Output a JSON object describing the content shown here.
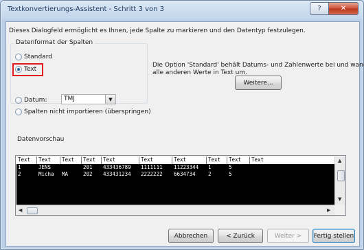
{
  "window": {
    "title": "Textkonvertierungs-Assistent - Schritt 3 von 3",
    "help_glyph": "?",
    "close_glyph": "✕"
  },
  "intro": "Dieses Dialogfeld ermöglicht es Ihnen, jede Spalte zu markieren und den Datentyp festzulegen.",
  "column_format": {
    "legend": "Datenformat der Spalten",
    "options": [
      {
        "label": "Standard",
        "selected": false
      },
      {
        "label": "Text",
        "selected": true
      },
      {
        "label": "Datum:",
        "selected": false
      },
      {
        "label": "Spalten nicht importieren (überspringen)",
        "selected": false
      }
    ],
    "date_value": "TMJ",
    "dropdown_glyph": "▼"
  },
  "description": {
    "line1": "Die Option 'Standard' behält Datums- und Zahlenwerte bei und wandelt",
    "line2": "alle anderen Werte in Text um."
  },
  "advanced_button": "Weitere...",
  "preview": {
    "legend": "Datenvorschau",
    "headers": [
      "Text",
      "Text",
      "Text",
      "Text",
      "Text",
      "Text",
      "Text",
      "Text",
      "Text",
      "Text"
    ],
    "rows": [
      [
        "1",
        "JENS",
        "",
        "201",
        "433436789",
        "1111111",
        "11223344",
        "1",
        "5",
        ""
      ],
      [
        "2",
        "Micha",
        "MA",
        "202",
        "433431234",
        "2222222",
        "6634734",
        "2",
        "5",
        ""
      ]
    ],
    "scroll_up": "▲",
    "scroll_down": "▼",
    "scroll_left": "◀",
    "scroll_right": "▶"
  },
  "buttons": {
    "cancel": "Abbrechen",
    "back": "< Zurück",
    "next": "Weiter >",
    "finish": "Fertig stellen"
  }
}
